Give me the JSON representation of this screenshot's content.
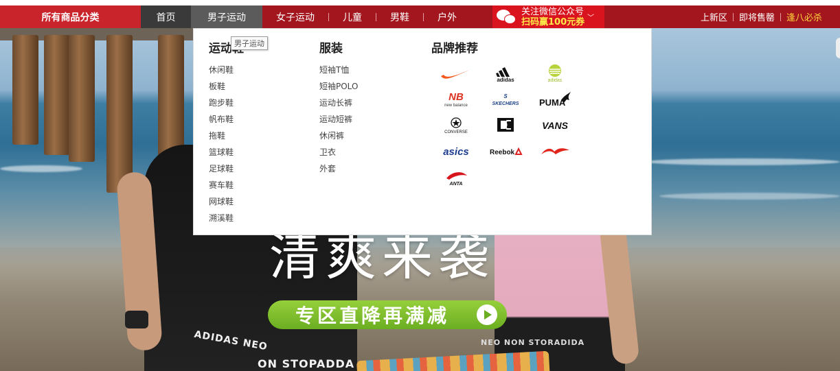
{
  "nav": {
    "all_categories": "所有商品分类",
    "items": [
      {
        "label": "首页"
      },
      {
        "label": "男子运动"
      },
      {
        "label": "女子运动"
      },
      {
        "label": "儿童"
      },
      {
        "label": "男鞋"
      },
      {
        "label": "户外"
      }
    ],
    "wechat": {
      "line1": "关注微信公众号",
      "line2": "扫码赢100元券"
    },
    "right_links": [
      "上新区",
      "即将售罄",
      "逢八必杀"
    ]
  },
  "dropdown": {
    "tooltip": "男子运动",
    "shoes": {
      "title": "运动鞋",
      "items": [
        "休闲鞋",
        "板鞋",
        "跑步鞋",
        "帆布鞋",
        "拖鞋",
        "篮球鞋",
        "足球鞋",
        "赛车鞋",
        "网球鞋",
        "溯溪鞋"
      ]
    },
    "apparel": {
      "title": "服装",
      "items": [
        "短袖T恤",
        "短袖POLO",
        "运动长裤",
        "运动短裤",
        "休闲裤",
        "卫衣",
        "外套"
      ]
    },
    "brands": {
      "title": "品牌推荐",
      "items": [
        {
          "icon": "nike-logo-icon",
          "text": ""
        },
        {
          "icon": "adidas-logo-icon",
          "text": "adidas"
        },
        {
          "icon": "adidas-originals-logo-icon",
          "text": "adidas"
        },
        {
          "icon": "new-balance-logo-icon",
          "text": "new balance"
        },
        {
          "icon": "skechers-logo-icon",
          "text": "SKECHERS"
        },
        {
          "icon": "puma-logo-icon",
          "text": "PUMA"
        },
        {
          "icon": "converse-logo-icon",
          "text": "CONVERSE"
        },
        {
          "icon": "dc-shoes-logo-icon",
          "text": ""
        },
        {
          "icon": "vans-logo-icon",
          "text": "VANS"
        },
        {
          "icon": "asics-logo-icon",
          "text": "asics"
        },
        {
          "icon": "reebok-logo-icon",
          "text": "Reebok"
        },
        {
          "icon": "li-ning-logo-icon",
          "text": ""
        },
        {
          "icon": "anta-logo-icon",
          "text": "ANTA"
        }
      ]
    }
  },
  "banner": {
    "headline": "清爽来袭",
    "cta": "专区直降再满减",
    "shirt_left_1": "ADIDAS NEO",
    "shirt_left_2": "ON STOPADDA",
    "shirt_right": "NEO NON STORADIDA",
    "colors": {
      "cta_green": "#7dbd2c",
      "nav_red": "#a3161e",
      "accent_red": "#d9141e"
    }
  }
}
